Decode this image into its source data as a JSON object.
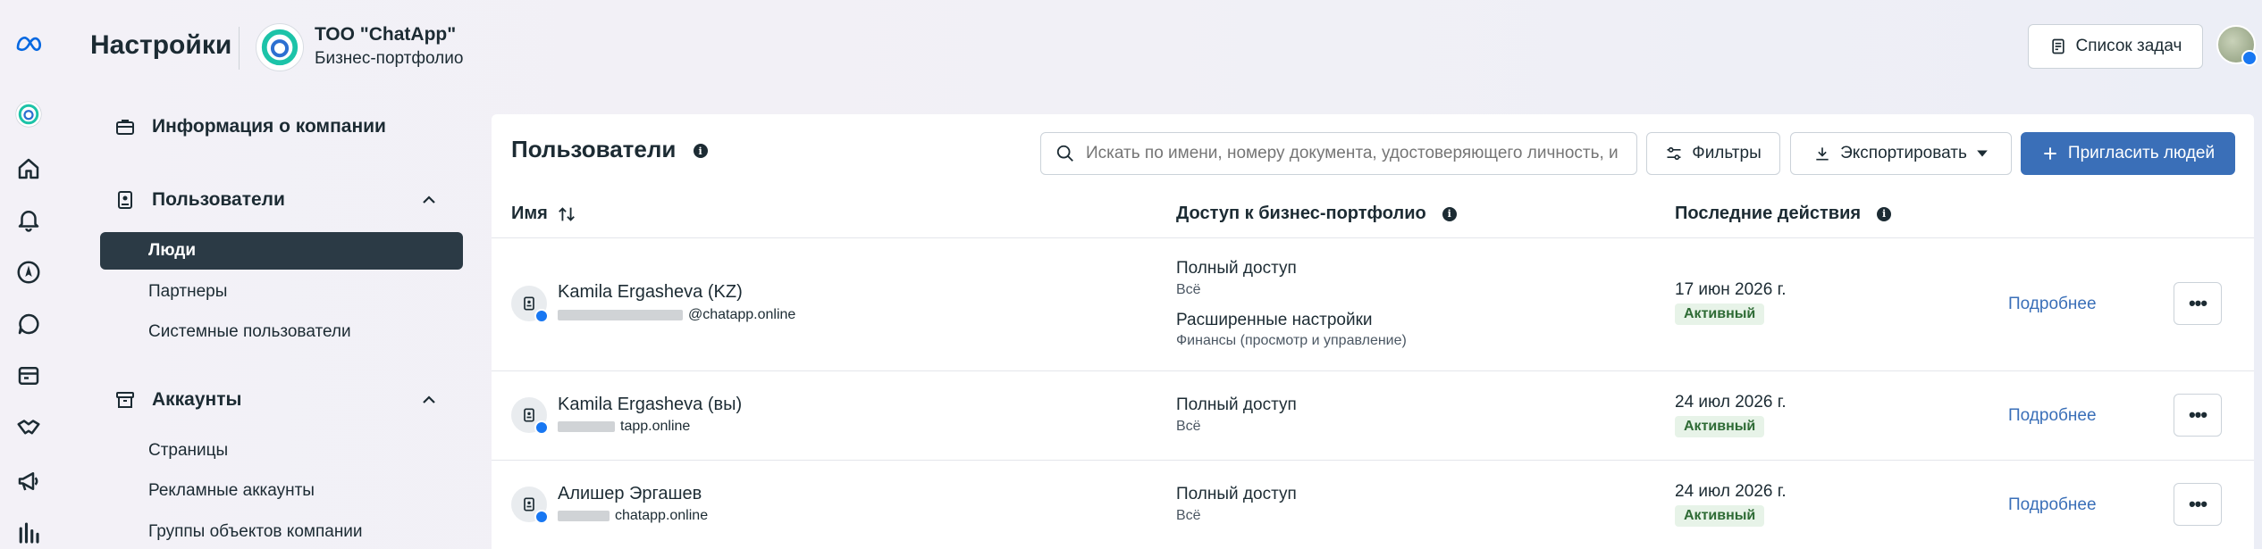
{
  "header": {
    "title": "Настройки",
    "company_name": "ТОО \"ChatApp\"",
    "company_subtitle": "Бизнес-портфолио",
    "tasks_button": "Список задач"
  },
  "rail_icons": [
    "meta-logo-icon",
    "chatapp-logo-icon",
    "home-icon",
    "bell-icon",
    "compass-icon",
    "chat-icon",
    "billing-icon",
    "handshake-icon",
    "megaphone-icon",
    "analytics-icon"
  ],
  "sidebar": {
    "company_info": "Информация о компании",
    "users_section": "Пользователи",
    "users_items": [
      "Люди",
      "Партнеры",
      "Системные пользователи"
    ],
    "accounts_section": "Аккаунты",
    "accounts_items": [
      "Страницы",
      "Рекламные аккаунты",
      "Группы объектов компании"
    ]
  },
  "main": {
    "title": "Пользователи",
    "search_placeholder": "Искать по имени, номеру документа, удостоверяющего личность, и",
    "filters_button": "Фильтры",
    "export_button": "Экспортировать",
    "invite_button": "Пригласить людей",
    "columns": {
      "name": "Имя",
      "access": "Доступ к бизнес-портфолио",
      "last_activity": "Последние действия"
    },
    "rows": [
      {
        "name": "Kamila Ergasheva (KZ)",
        "email_visible": "@chatapp.online",
        "access": [
          {
            "title": "Полный доступ",
            "detail": "Всё"
          },
          {
            "title": "Расширенные настройки",
            "detail": "Финансы (просмотр и управление)"
          }
        ],
        "date": "17 июн 2026 г.",
        "status": "Активный",
        "details_link": "Подробнее"
      },
      {
        "name": "Kamila Ergasheva (вы)",
        "email_visible": "tapp.online",
        "access": [
          {
            "title": "Полный доступ",
            "detail": "Всё"
          }
        ],
        "date": "24 июл 2026 г.",
        "status": "Активный",
        "details_link": "Подробнее"
      },
      {
        "name": "Алишер Эргашев",
        "email_visible": "chatapp.online",
        "access": [
          {
            "title": "Полный доступ",
            "detail": "Всё"
          }
        ],
        "date": "24 июл 2026 г.",
        "status": "Активный",
        "details_link": "Подробнее"
      }
    ]
  },
  "colors": {
    "primary": "#3a6fb8",
    "active_nav": "#2b3a45",
    "badge_bg": "#e7f3e8",
    "badge_text": "#2e6b35"
  }
}
